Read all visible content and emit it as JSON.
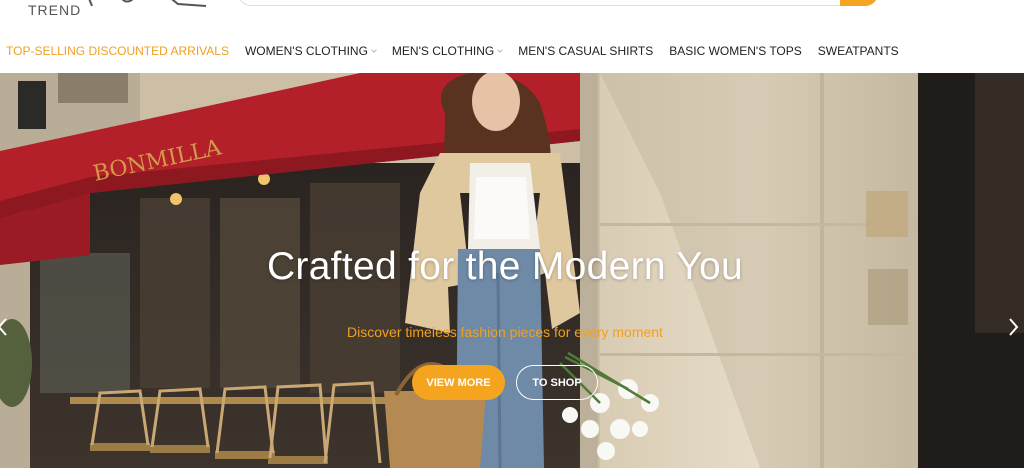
{
  "brand": {
    "name": "TREND"
  },
  "nav": {
    "items": [
      {
        "label": "TOP-SELLING DISCOUNTED ARRIVALS",
        "active": true,
        "dropdown": false
      },
      {
        "label": "WOMEN'S CLOTHING",
        "active": false,
        "dropdown": true
      },
      {
        "label": "MEN'S CLOTHING",
        "active": false,
        "dropdown": true
      },
      {
        "label": "MEN'S CASUAL SHIRTS",
        "active": false,
        "dropdown": false
      },
      {
        "label": "BASIC WOMEN'S TOPS",
        "active": false,
        "dropdown": false
      },
      {
        "label": "SWEATPANTS",
        "active": false,
        "dropdown": false
      }
    ]
  },
  "hero": {
    "title": "Crafted for the Modern You",
    "subtitle": "Discover timeless fashion pieces for every moment",
    "primary_button": "VIEW MORE",
    "secondary_button": "TO SHOP"
  },
  "icons": {
    "search": "search-icon",
    "prev": "chevron-left-icon",
    "next": "chevron-right-icon"
  },
  "colors": {
    "accent": "#f4a41e",
    "nav_active": "#f0a020",
    "text": "#222222",
    "awning": "#b3202a"
  }
}
